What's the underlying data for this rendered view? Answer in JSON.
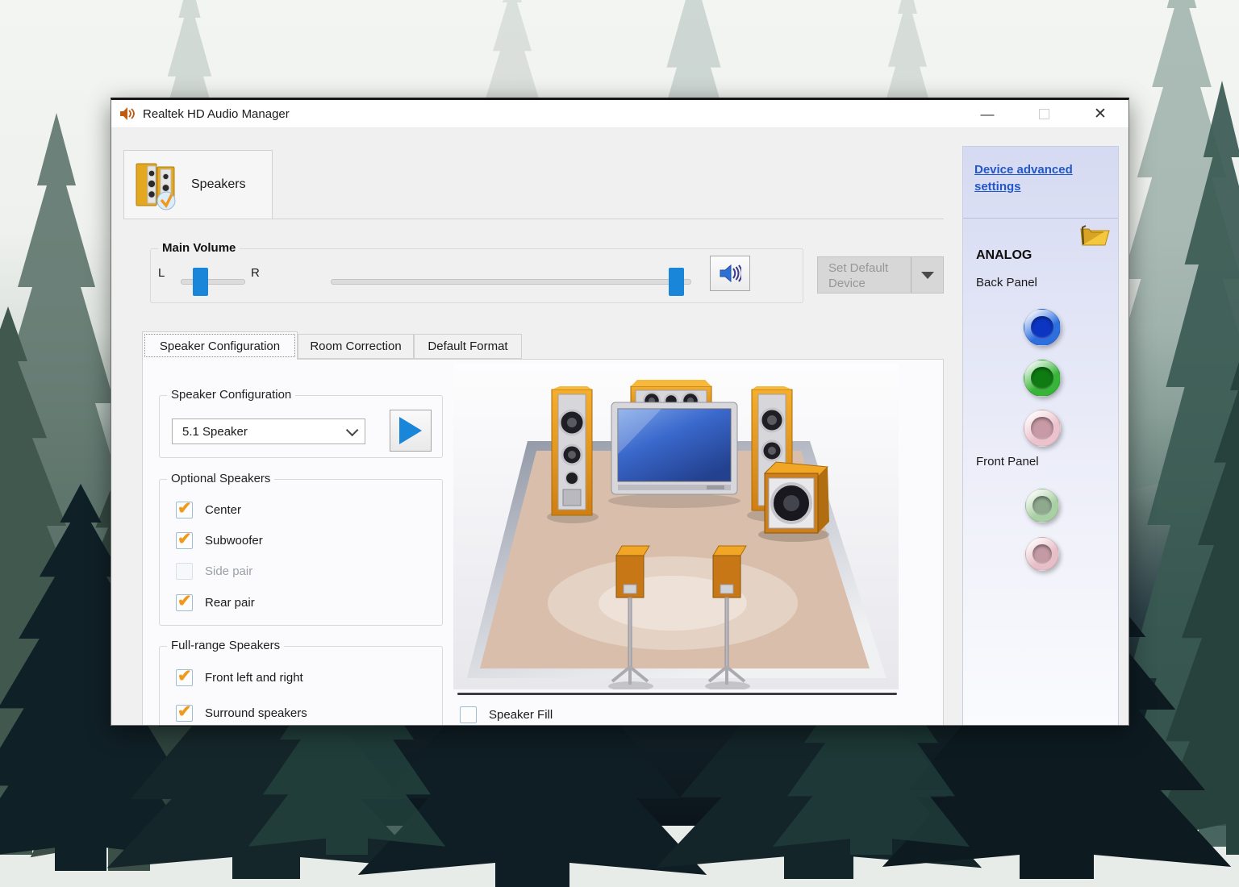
{
  "colors": {
    "accent_blue": "#1a86d9",
    "check_orange": "#f0991c",
    "link_blue": "#2257c8",
    "speaker_icon_blue": "#2e6fd4"
  },
  "window": {
    "title": "Realtek HD Audio Manager",
    "controls": {
      "minimize_glyph": "—",
      "close_glyph": "✕"
    }
  },
  "device_tab": {
    "label": "Speakers"
  },
  "main_volume": {
    "group_label": "Main Volume",
    "left_label": "L",
    "right_label": "R",
    "balance_position": "30%",
    "volume_position": "96%",
    "mute_icon": "speaker-volume-icon"
  },
  "set_default": {
    "label": "Set Default Device"
  },
  "tabs": [
    {
      "label": "Speaker Configuration",
      "active": true
    },
    {
      "label": "Room Correction",
      "active": false
    },
    {
      "label": "Default Format",
      "active": false
    }
  ],
  "speaker_config": {
    "group_label": "Speaker Configuration",
    "dropdown_value": "5.1 Speaker"
  },
  "optional_speakers": {
    "group_label": "Optional Speakers",
    "items": [
      {
        "label": "Center",
        "checked": true,
        "disabled": false
      },
      {
        "label": "Subwoofer",
        "checked": true,
        "disabled": false
      },
      {
        "label": "Side pair",
        "checked": false,
        "disabled": true
      },
      {
        "label": "Rear pair",
        "checked": true,
        "disabled": false
      }
    ]
  },
  "full_range": {
    "group_label": "Full-range Speakers",
    "items": [
      {
        "label": "Front left and right",
        "checked": true,
        "disabled": false
      },
      {
        "label": "Surround speakers",
        "checked": true,
        "disabled": false
      }
    ]
  },
  "speaker_fill": {
    "label": "Speaker Fill",
    "checked": false
  },
  "side_panel": {
    "advanced_link": "Device advanced settings",
    "section_title": "ANALOG",
    "back_panel_label": "Back Panel",
    "front_panel_label": "Front Panel",
    "back_jacks": [
      {
        "name": "blue-line-in-jack",
        "ring": "#2e6fe0",
        "hole": "#0c35c2"
      },
      {
        "name": "green-line-out-jack",
        "ring": "#38b438",
        "hole": "#0e7c12"
      },
      {
        "name": "pink-mic-jack",
        "ring": "#ecc3cd",
        "hole": "#c79aa6"
      }
    ],
    "front_jacks": [
      {
        "name": "green-headphone-jack",
        "ring": "#a9d0a4",
        "hole": "#8fa98f"
      },
      {
        "name": "pink-mic-jack",
        "ring": "#e7bfc8",
        "hole": "#c49aa4"
      }
    ]
  }
}
